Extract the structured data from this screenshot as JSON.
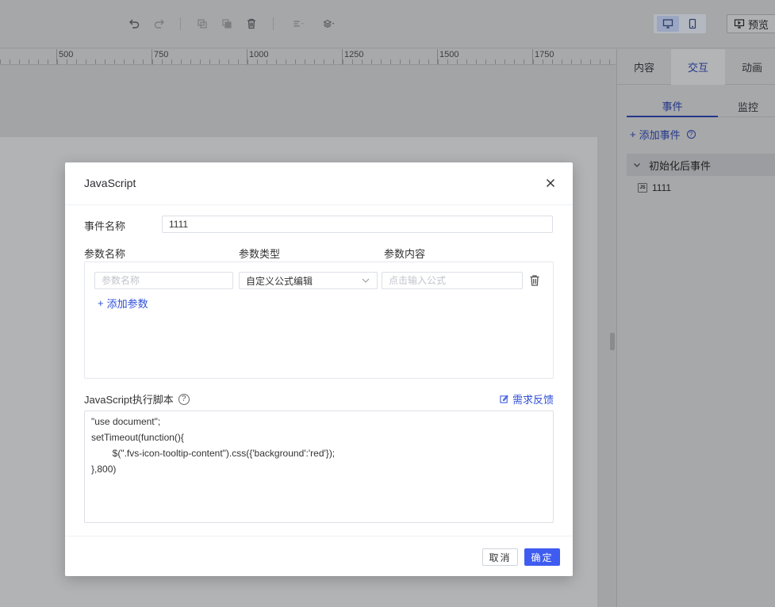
{
  "toolbar": {
    "icons": [
      "undo-icon",
      "redo-icon",
      "copy-icon",
      "paste-icon",
      "delete-icon",
      "align-icon",
      "layers-icon"
    ],
    "preview_label": "预览"
  },
  "ruler": {
    "labels": [
      "500",
      "750",
      "1000",
      "1250",
      "1500",
      "1750"
    ]
  },
  "right_panel": {
    "tabs": [
      "内容",
      "交互",
      "动画"
    ],
    "active_tab": "交互",
    "subtabs": [
      "事件",
      "监控"
    ],
    "add_event_label": "添加事件",
    "event_group_label": "初始化后事件",
    "event_item_label": "1111"
  },
  "modal": {
    "title": "JavaScript",
    "event_name_label": "事件名称",
    "event_name_value": "1111",
    "param_name_header": "参数名称",
    "param_type_header": "参数类型",
    "param_content_header": "参数内容",
    "param_name_placeholder": "参数名称",
    "param_type_value": "自定义公式编辑",
    "param_content_placeholder": "点击输入公式",
    "add_param_label": "添加参数",
    "script_label": "JavaScript执行脚本",
    "feedback_label": "需求反馈",
    "script_code": "\"use document\";\nsetTimeout(function(){\n        $(\".fvs-icon-tooltip-content\").css({'background':'red'});\n},800)",
    "cancel_label": "取消",
    "ok_label": "确定"
  },
  "colors": {
    "primary": "#3f5cf0",
    "link": "#2f4fd6"
  }
}
